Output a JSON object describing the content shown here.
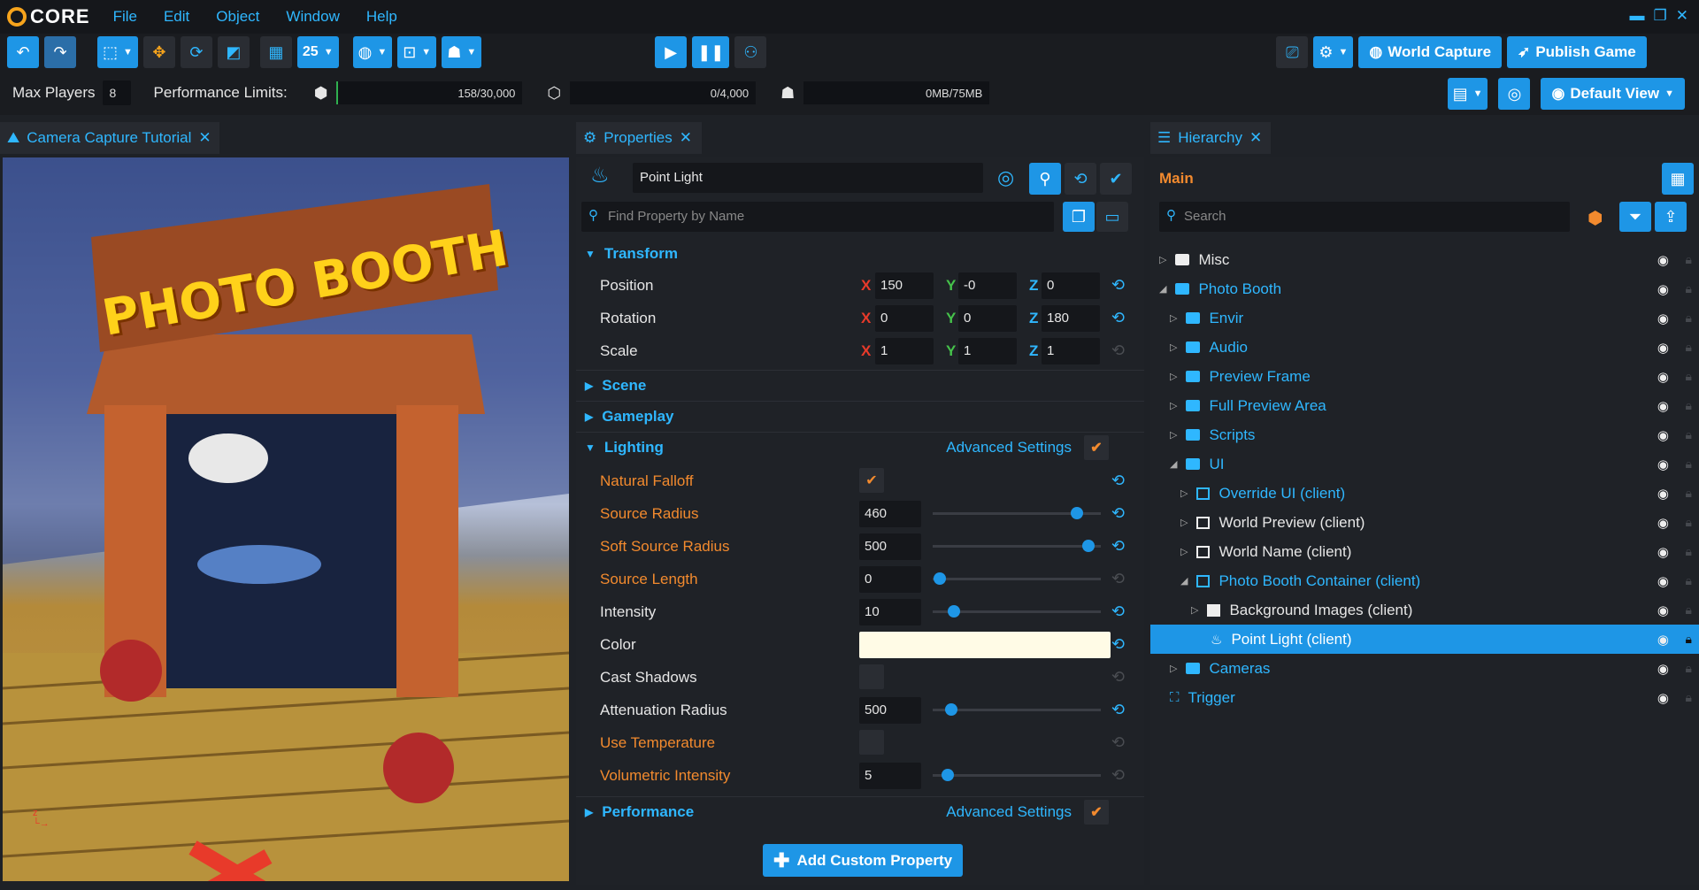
{
  "app": {
    "name": "CORE"
  },
  "menu": [
    "File",
    "Edit",
    "Object",
    "Window",
    "Help"
  ],
  "toolbar": {
    "grid_size": "25",
    "world_capture": "World Capture",
    "publish_game": "Publish Game"
  },
  "stats": {
    "max_players_label": "Max Players",
    "max_players_value": "8",
    "perf_label": "Performance Limits:",
    "objects": "158/30,000",
    "networked": "0/4,000",
    "memory": "0MB/75MB",
    "default_view": "Default View"
  },
  "viewport": {
    "tab": "Camera Capture Tutorial",
    "sign_text": "PHOTO BOOTH"
  },
  "properties": {
    "tab": "Properties",
    "object_name": "Point Light",
    "search_placeholder": "Find Property by Name",
    "sections": {
      "transform": "Transform",
      "scene": "Scene",
      "gameplay": "Gameplay",
      "lighting": "Lighting",
      "performance": "Performance"
    },
    "advanced": "Advanced Settings",
    "axis": {
      "x": "X",
      "y": "Y",
      "z": "Z"
    },
    "transform": [
      {
        "label": "Position",
        "x": "150",
        "y": "-0",
        "z": "0"
      },
      {
        "label": "Rotation",
        "x": "0",
        "y": "0",
        "z": "180"
      },
      {
        "label": "Scale",
        "x": "1",
        "y": "1",
        "z": "1"
      }
    ],
    "lighting": {
      "natural_falloff": "Natural Falloff",
      "source_radius": "Source Radius",
      "source_radius_value": "460",
      "soft_source_radius": "Soft Source Radius",
      "soft_source_radius_value": "500",
      "source_length": "Source Length",
      "source_length_value": "0",
      "intensity": "Intensity",
      "intensity_value": "10",
      "color": "Color",
      "color_hex": "#fffbe6",
      "cast_shadows": "Cast Shadows",
      "attenuation_radius": "Attenuation Radius",
      "attenuation_radius_value": "500",
      "use_temperature": "Use Temperature",
      "volumetric_intensity": "Volumetric Intensity",
      "volumetric_intensity_value": "5"
    },
    "add_custom": "Add Custom Property"
  },
  "hierarchy": {
    "tab": "Hierarchy",
    "root": "Main",
    "search_placeholder": "Search",
    "items": [
      {
        "label": "Misc"
      },
      {
        "label": "Photo Booth"
      },
      {
        "label": "Envir"
      },
      {
        "label": "Audio"
      },
      {
        "label": "Preview Frame"
      },
      {
        "label": "Full Preview Area"
      },
      {
        "label": "Scripts"
      },
      {
        "label": "UI"
      },
      {
        "label": "Override UI (client)"
      },
      {
        "label": "World Preview (client)"
      },
      {
        "label": "World Name (client)"
      },
      {
        "label": "Photo Booth Container (client)"
      },
      {
        "label": "Background Images (client)"
      },
      {
        "label": "Point Light (client)"
      },
      {
        "label": "Cameras"
      },
      {
        "label": "Trigger"
      }
    ]
  },
  "colors": {
    "accent": "#2fb7ff",
    "button": "#1e96e6",
    "orange": "#f28a2e",
    "selection": "#1e96e6"
  }
}
